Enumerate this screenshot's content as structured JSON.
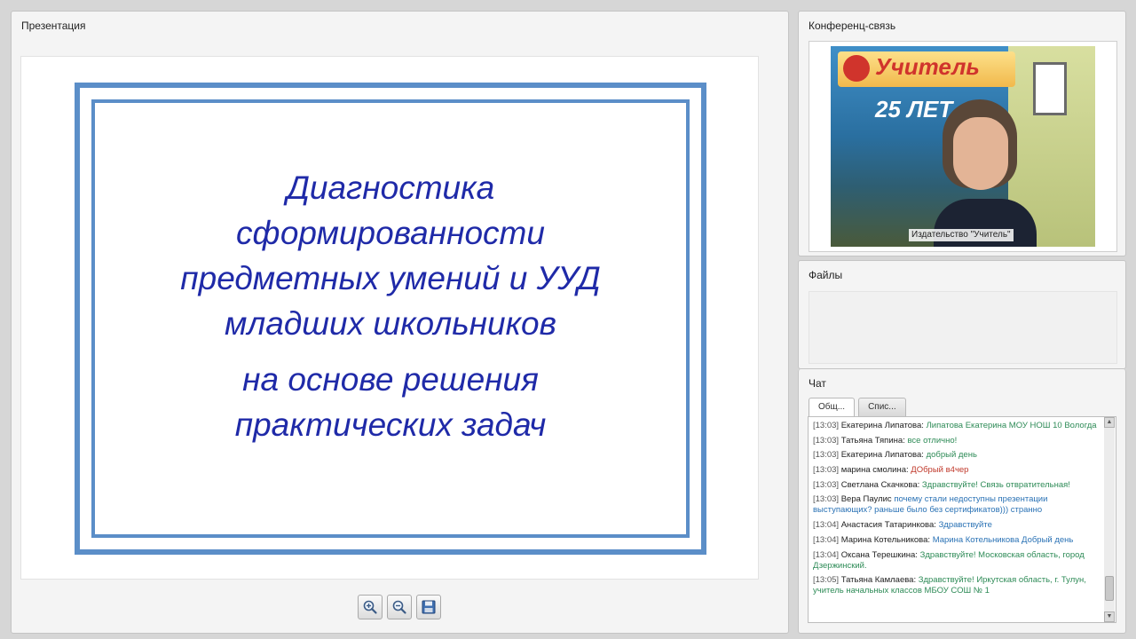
{
  "presentation": {
    "title": "Презентация",
    "slide": {
      "lines": [
        "Диагностика",
        "сформированности",
        "предметных умений и УУД",
        "младших школьников",
        "на основе решения",
        "практических задач"
      ]
    },
    "toolbar": {
      "zoom_in_icon": "zoom-in-icon",
      "zoom_out_icon": "zoom-out-icon",
      "save_icon": "save-icon"
    }
  },
  "conference": {
    "title": "Конференц-связь",
    "video": {
      "brand": "Учитель",
      "big_text": "25 ЛЕТ",
      "caption": "Издательство \"Учитель\""
    }
  },
  "files": {
    "title": "Файлы"
  },
  "chat": {
    "title": "Чат",
    "tabs": [
      "Общ...",
      "Спис..."
    ],
    "messages": [
      {
        "time": "[13:03]",
        "author": "Екатерина Липатова:",
        "text": "Липатова Екатерина МОУ НОШ 10 Вологда",
        "color": "green"
      },
      {
        "time": "[13:03]",
        "author": "Татьяна Тяпина:",
        "text": "все отлично!",
        "color": "green"
      },
      {
        "time": "[13:03]",
        "author": "Екатерина Липатова:",
        "text": "добрый день",
        "color": "green"
      },
      {
        "time": "[13:03]",
        "author": "марина смолина:",
        "text": "ДОбрый в4чер",
        "color": "red"
      },
      {
        "time": "[13:03]",
        "author": "Светлана Скачкова:",
        "text": "Здравствуйте! Связь отвратительная!",
        "color": "green"
      },
      {
        "time": "[13:03]",
        "author": "Вера Паулис",
        "text": "почему стали недоступны презентации выступающих? раньше было без сертификатов))) странно",
        "color": "blue"
      },
      {
        "time": "[13:04]",
        "author": "Анастасия Татаринкова:",
        "text": "Здравствуйте",
        "color": "blue"
      },
      {
        "time": "[13:04]",
        "author": "Марина Котельникова:",
        "text": "Марина Котельникова Добрый день",
        "color": "blue"
      },
      {
        "time": "[13:04]",
        "author": "Оксана Терешкина:",
        "text": "Здравствуйте! Московская область, город Дзержинский.",
        "color": "green"
      },
      {
        "time": "[13:05]",
        "author": "Татьяна Камлаева:",
        "text": "Здравствуйте! Иркутская область, г. Тулун, учитель начальных классов МБОУ СОШ № 1",
        "color": "green"
      }
    ]
  }
}
